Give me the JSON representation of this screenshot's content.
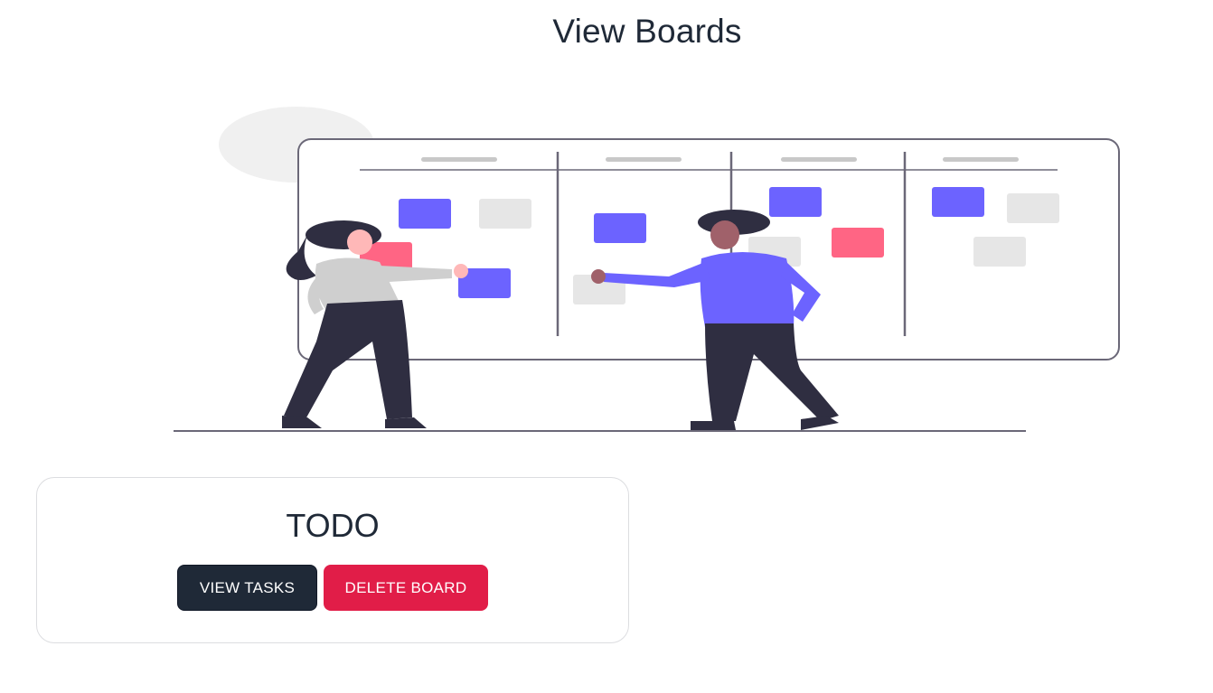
{
  "page": {
    "title": "View Boards"
  },
  "hero": {
    "illustration": "kanban-board-people-illustration",
    "colors": {
      "purple": "#6c63ff",
      "pink": "#ff6584",
      "gray_note": "#e6e6e6",
      "dark": "#2f2e41",
      "skin": "#a0616a",
      "skin_light": "#ffb8b8"
    }
  },
  "boards": [
    {
      "name": "TODO",
      "view_label": "VIEW TASKS",
      "delete_label": "DELETE BOARD"
    }
  ],
  "colors": {
    "primary_dark": "#1f2937",
    "danger": "#e11d48"
  }
}
